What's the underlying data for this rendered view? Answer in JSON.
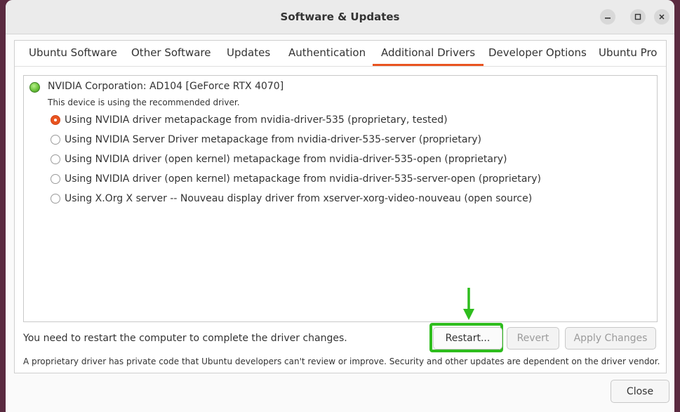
{
  "window": {
    "title": "Software & Updates"
  },
  "tabs": [
    {
      "label": "Ubuntu Software",
      "active": false
    },
    {
      "label": "Other Software",
      "active": false
    },
    {
      "label": "Updates",
      "active": false
    },
    {
      "label": "Authentication",
      "active": false
    },
    {
      "label": "Additional Drivers",
      "active": true
    },
    {
      "label": "Developer Options",
      "active": false
    },
    {
      "label": "Ubuntu Pro",
      "active": false
    }
  ],
  "device": {
    "name": "NVIDIA Corporation: AD104 [GeForce RTX 4070]",
    "status": "This device is using the recommended driver.",
    "status_icon": "green-status-led",
    "options": [
      {
        "label": "Using NVIDIA driver metapackage from nvidia-driver-535 (proprietary, tested)",
        "selected": true
      },
      {
        "label": "Using NVIDIA Server Driver metapackage from nvidia-driver-535-server (proprietary)",
        "selected": false
      },
      {
        "label": "Using NVIDIA driver (open kernel) metapackage from nvidia-driver-535-open (proprietary)",
        "selected": false
      },
      {
        "label": "Using NVIDIA driver (open kernel) metapackage from nvidia-driver-535-server-open (proprietary)",
        "selected": false
      },
      {
        "label": "Using X.Org X server -- Nouveau display driver from xserver-xorg-video-nouveau (open source)",
        "selected": false
      }
    ]
  },
  "actions": {
    "restart_message": "You need to restart the computer to complete the driver changes.",
    "restart_label": "Restart...",
    "revert_label": "Revert",
    "apply_label": "Apply Changes"
  },
  "footnote": "A proprietary driver has private code that Ubuntu developers can't review or improve. Security and other updates are dependent on the driver vendor.",
  "close_label": "Close",
  "colors": {
    "accent": "#e95420",
    "highlight": "#2ebd1d",
    "status_led": "#6cc33c"
  }
}
